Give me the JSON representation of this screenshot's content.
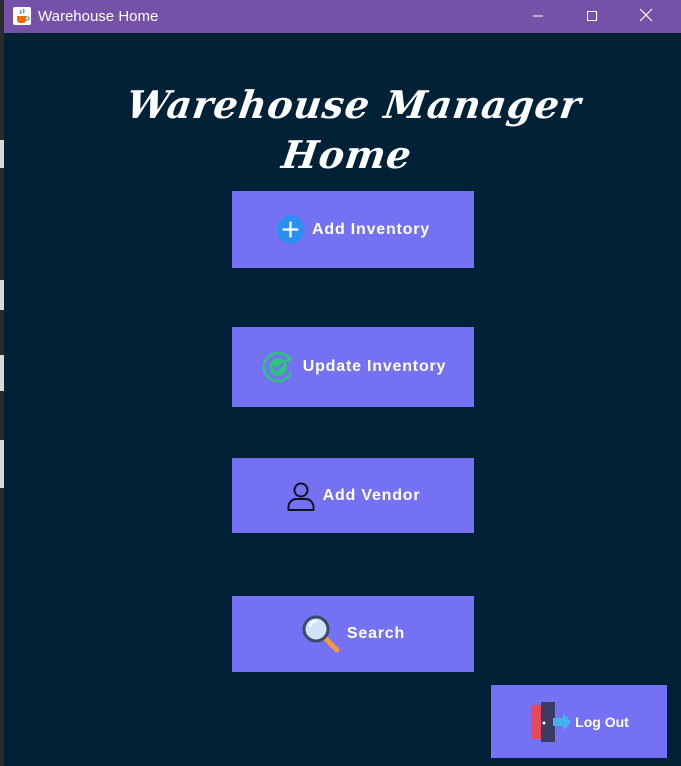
{
  "window": {
    "title": "Warehouse Home",
    "app_icon": "java-cup-icon",
    "controls": [
      "minimize-icon",
      "maximize-icon",
      "close-icon"
    ]
  },
  "main": {
    "heading": "Warehouse Manager Home"
  },
  "buttons": {
    "add_inventory": {
      "label": "Add Inventory",
      "icon": "plus-circle-icon"
    },
    "update_inventory": {
      "label": "Update Inventory",
      "icon": "check-refresh-icon"
    },
    "add_vendor": {
      "label": "Add Vendor",
      "icon": "person-icon"
    },
    "search": {
      "label": "Search",
      "icon": "magnifier-icon"
    },
    "log_out": {
      "label": "Log Out",
      "icon": "exit-door-icon"
    }
  },
  "colors": {
    "background": "#012136",
    "titlebar": "#7651a8",
    "button": "#7471f2",
    "text": "#ffffff"
  }
}
